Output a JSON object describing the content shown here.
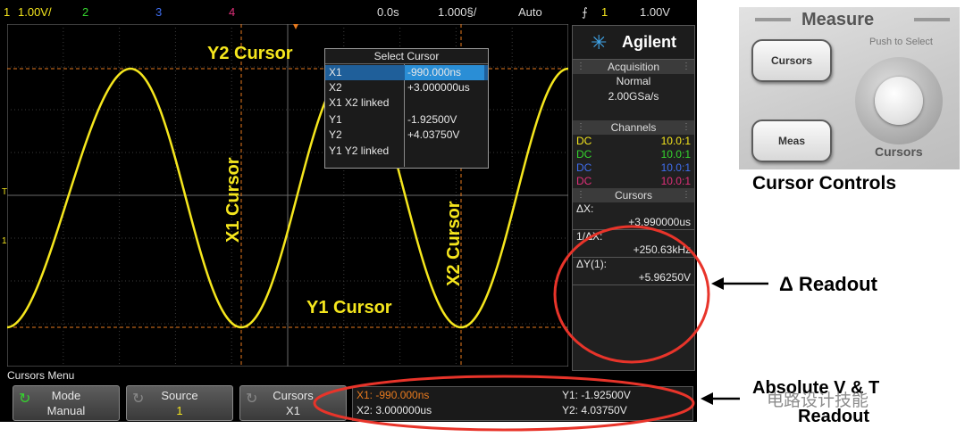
{
  "topbar": {
    "ch1_num": "1",
    "ch1_scale": "1.00V/",
    "ch2_num": "2",
    "ch3_num": "3",
    "ch4_num": "4",
    "time_delay": "0.0s",
    "timebase": "1.000§/",
    "trigger_mode": "Auto",
    "trigger_slope": "⨍",
    "trigger_src": "1",
    "trigger_level": "1.00V"
  },
  "labels": {
    "y2_cursor": "Y2 Cursor",
    "x1_cursor": "X1 Cursor",
    "x2_cursor": "X2 Cursor",
    "y1_cursor": "Y1 Cursor"
  },
  "markers": {
    "trigger_t": "T",
    "ground_1": "1"
  },
  "popup": {
    "title": "Select Cursor",
    "rows": [
      {
        "name": "X1",
        "value": "-990.000ns"
      },
      {
        "name": "X2",
        "value": "+3.000000us"
      },
      {
        "name": "X1 X2 linked",
        "value": ""
      },
      {
        "name": "Y1",
        "value": "-1.92500V"
      },
      {
        "name": "Y2",
        "value": "+4.03750V"
      },
      {
        "name": "Y1 Y2 linked",
        "value": ""
      }
    ]
  },
  "panel": {
    "brand": "Agilent",
    "acquisition_title": "Acquisition",
    "acq_mode": "Normal",
    "sample_rate": "2.00GSa/s",
    "channels_title": "Channels",
    "channels": [
      {
        "coupling": "DC",
        "probe": "10.0:1",
        "color": "#f5e61d"
      },
      {
        "coupling": "DC",
        "probe": "10.0:1",
        "color": "#35d42e"
      },
      {
        "coupling": "DC",
        "probe": "10.0:1",
        "color": "#3f6ef0"
      },
      {
        "coupling": "DC",
        "probe": "10.0:1",
        "color": "#e0307a"
      }
    ],
    "cursors_title": "Cursors",
    "dx_label": "ΔX:",
    "dx_value": "+3.990000us",
    "inv_dx_label": "1/ΔX:",
    "inv_dx_value": "+250.63kHz",
    "dy_label": "ΔY(1):",
    "dy_value": "+5.96250V"
  },
  "bottom": {
    "menu_title": "Cursors Menu",
    "softkeys": [
      {
        "label": "Mode",
        "value": "Manual"
      },
      {
        "label": "Source",
        "value": "1"
      },
      {
        "label": "Cursors",
        "value": "X1"
      }
    ],
    "readout": {
      "x1": "X1: -990.000ns",
      "x2": "X2: 3.000000us",
      "y1": "Y1: -1.92500V",
      "y2": "Y2: 4.03750V"
    }
  },
  "photo": {
    "measure_title": "Measure",
    "push_hint": "Push to Select",
    "cursors_button": "Cursors",
    "meas_button": "Meas",
    "knob_label": "Cursors"
  },
  "annotations": {
    "cursor_controls": "Cursor Controls",
    "delta_readout": "Δ Readout",
    "absolute_line1": "Absolute V & T",
    "absolute_line2": "Readout",
    "watermark": "电路设计技能"
  },
  "colors": {
    "ch1": "#f5e61d",
    "ch2": "#35d42e",
    "ch3": "#3f6ef0",
    "ch4": "#e0307a",
    "cursor_line": "#e87a1e",
    "highlight": "#e8342a"
  }
}
